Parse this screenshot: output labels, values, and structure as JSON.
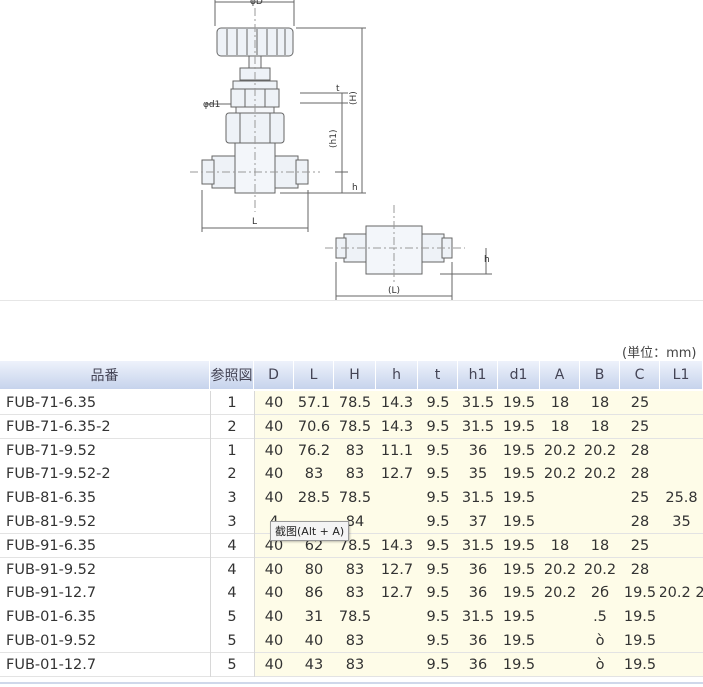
{
  "drawing": {
    "dims_left": [
      "φD",
      "φd1",
      "t",
      "(H)",
      "(h1)",
      "h",
      "L"
    ],
    "dims_right": [
      "h",
      "(L)"
    ]
  },
  "unit_label": "(単位：mm)",
  "table": {
    "columns": [
      "品番",
      "参照図",
      "D",
      "L",
      "H",
      "h",
      "t",
      "h1",
      "d1",
      "A",
      "B",
      "C",
      "L1"
    ],
    "rows": [
      [
        "FUB-71-6.35",
        "1",
        "40",
        "57.1",
        "78.5",
        "14.3",
        "9.5",
        "31.5",
        "19.5",
        "18",
        "18",
        "25",
        ""
      ],
      [
        "FUB-71-6.35-2",
        "2",
        "40",
        "70.6",
        "78.5",
        "14.3",
        "9.5",
        "31.5",
        "19.5",
        "18",
        "18",
        "25",
        ""
      ],
      [
        "FUB-71-9.52",
        "1",
        "40",
        "76.2",
        "83",
        "11.1",
        "9.5",
        "36",
        "19.5",
        "20.2",
        "20.2",
        "28",
        ""
      ],
      [
        "FUB-71-9.52-2",
        "2",
        "40",
        "83",
        "83",
        "12.7",
        "9.5",
        "35",
        "19.5",
        "20.2",
        "20.2",
        "28",
        ""
      ],
      [
        "FUB-81-6.35",
        "3",
        "40",
        "28.5",
        "78.5",
        "",
        "9.5",
        "31.5",
        "19.5",
        "",
        "",
        "25",
        "25.8"
      ],
      [
        "FUB-81-9.52",
        "3",
        "4",
        "",
        "84",
        "",
        "9.5",
        "37",
        "19.5",
        "",
        "",
        "28",
        "35"
      ],
      [
        "FUB-91-6.35",
        "4",
        "40",
        "62",
        "78.5",
        "14.3",
        "9.5",
        "31.5",
        "19.5",
        "18",
        "18",
        "25",
        ""
      ],
      [
        "FUB-91-9.52",
        "4",
        "40",
        "80",
        "83",
        "12.7",
        "9.5",
        "36",
        "19.5",
        "20.2",
        "20.2",
        "28",
        ""
      ],
      [
        "FUB-91-12.7",
        "4",
        "40",
        "86",
        "83",
        "12.7",
        "9.5",
        "36",
        "19.5",
        "20.2",
        "2б",
        "19.5",
        "20.2 2"
      ],
      [
        "FUB-01-6.35",
        "5",
        "40",
        "31",
        "78.5",
        "",
        "9.5",
        "31.5",
        "19.5",
        "",
        ".5",
        "19.5",
        ""
      ],
      [
        "FUB-01-9.52",
        "5",
        "40",
        "40",
        "83",
        "",
        "9.5",
        "36",
        "19.5",
        "",
        "ò",
        "19.5",
        ""
      ],
      [
        "FUB-01-12.7",
        "5",
        "40",
        "43",
        "83",
        "",
        "9.5",
        "36",
        "19.5",
        "",
        "ò",
        "19.5",
        ""
      ]
    ]
  },
  "tooltip": "截图(Alt + A)"
}
